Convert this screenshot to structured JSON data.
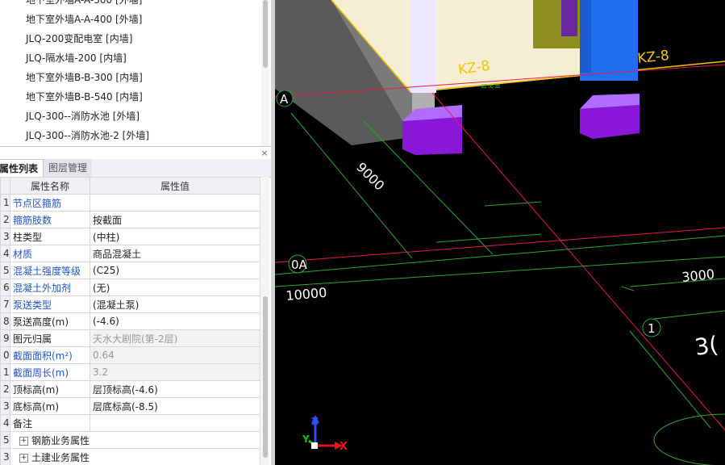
{
  "component_list": {
    "items": [
      {
        "label": "地下室外墙A-A-300 [外墙]"
      },
      {
        "label": "地下室外墙A-A-400 [外墙]"
      },
      {
        "label": "JLQ-200变配电室 [内墙]"
      },
      {
        "label": "JLQ-隔水墙-200 [内墙]"
      },
      {
        "label": "地下室外墙B-B-300 [内墙]"
      },
      {
        "label": "地下室外墙B-B-540 [内墙]"
      },
      {
        "label": "JLQ-300--消防水池 [外墙]"
      },
      {
        "label": "JLQ-300--消防水池-2 [外墙]"
      }
    ]
  },
  "panel": {
    "close_glyph": "×"
  },
  "tabs": {
    "properties": "属性列表",
    "layers": "图层管理"
  },
  "property_table": {
    "header_name": "属性名称",
    "header_value": "属性值",
    "rows": [
      {
        "num": "1",
        "name": "节点区箍筋",
        "value": ""
      },
      {
        "num": "2",
        "name": "箍筋肢数",
        "value": "按截面"
      },
      {
        "num": "3",
        "name": "柱类型",
        "value": "(中柱)"
      },
      {
        "num": "4",
        "name": "材质",
        "value": "商品混凝土"
      },
      {
        "num": "5",
        "name": "混凝土强度等级",
        "value": "(C25)"
      },
      {
        "num": "6",
        "name": "混凝土外加剂",
        "value": "(无)"
      },
      {
        "num": "7",
        "name": "泵送类型",
        "value": "(混凝土泵)"
      },
      {
        "num": "8",
        "name": "泵送高度(m)",
        "value": "(-4.6)"
      },
      {
        "num": "9",
        "name": "图元归属",
        "value": "天水大剧院(第-2层)"
      },
      {
        "num": "0",
        "name": "截面面积(m²)",
        "value": "0.64"
      },
      {
        "num": "1",
        "name": "截面周长(m)",
        "value": "3.2"
      },
      {
        "num": "2",
        "name": "顶标高(m)",
        "value": "层顶标高(-4.6)"
      },
      {
        "num": "3",
        "name": "底标高(m)",
        "value": "层底标高(-8.5)"
      },
      {
        "num": "4",
        "name": "备注",
        "value": ""
      },
      {
        "num": "5",
        "name": "钢筋业务属性",
        "value": "",
        "expand": "+"
      },
      {
        "num": "3",
        "name": "土建业务属性",
        "value": "",
        "expand": "+"
      }
    ]
  },
  "viewport": {
    "axis_labels": {
      "a": "A",
      "zero_a": "0A",
      "one": "1"
    },
    "dimensions": {
      "d9000": "9000",
      "d10000": "10000",
      "d3000": "3000",
      "d3partial": "3("
    },
    "element_labels": {
      "kz_left": "KZ-8",
      "kz_right": "KZ-8"
    },
    "coord_axes": {
      "x": "X",
      "y": "Y",
      "z": "Z"
    },
    "colors": {
      "column_blue": "#1f6ff0",
      "column_purple": "#8a16d8",
      "axis_red": "#e8194a",
      "dim_green": "#2aa82a",
      "beam_yellow": "#f5c400"
    }
  }
}
